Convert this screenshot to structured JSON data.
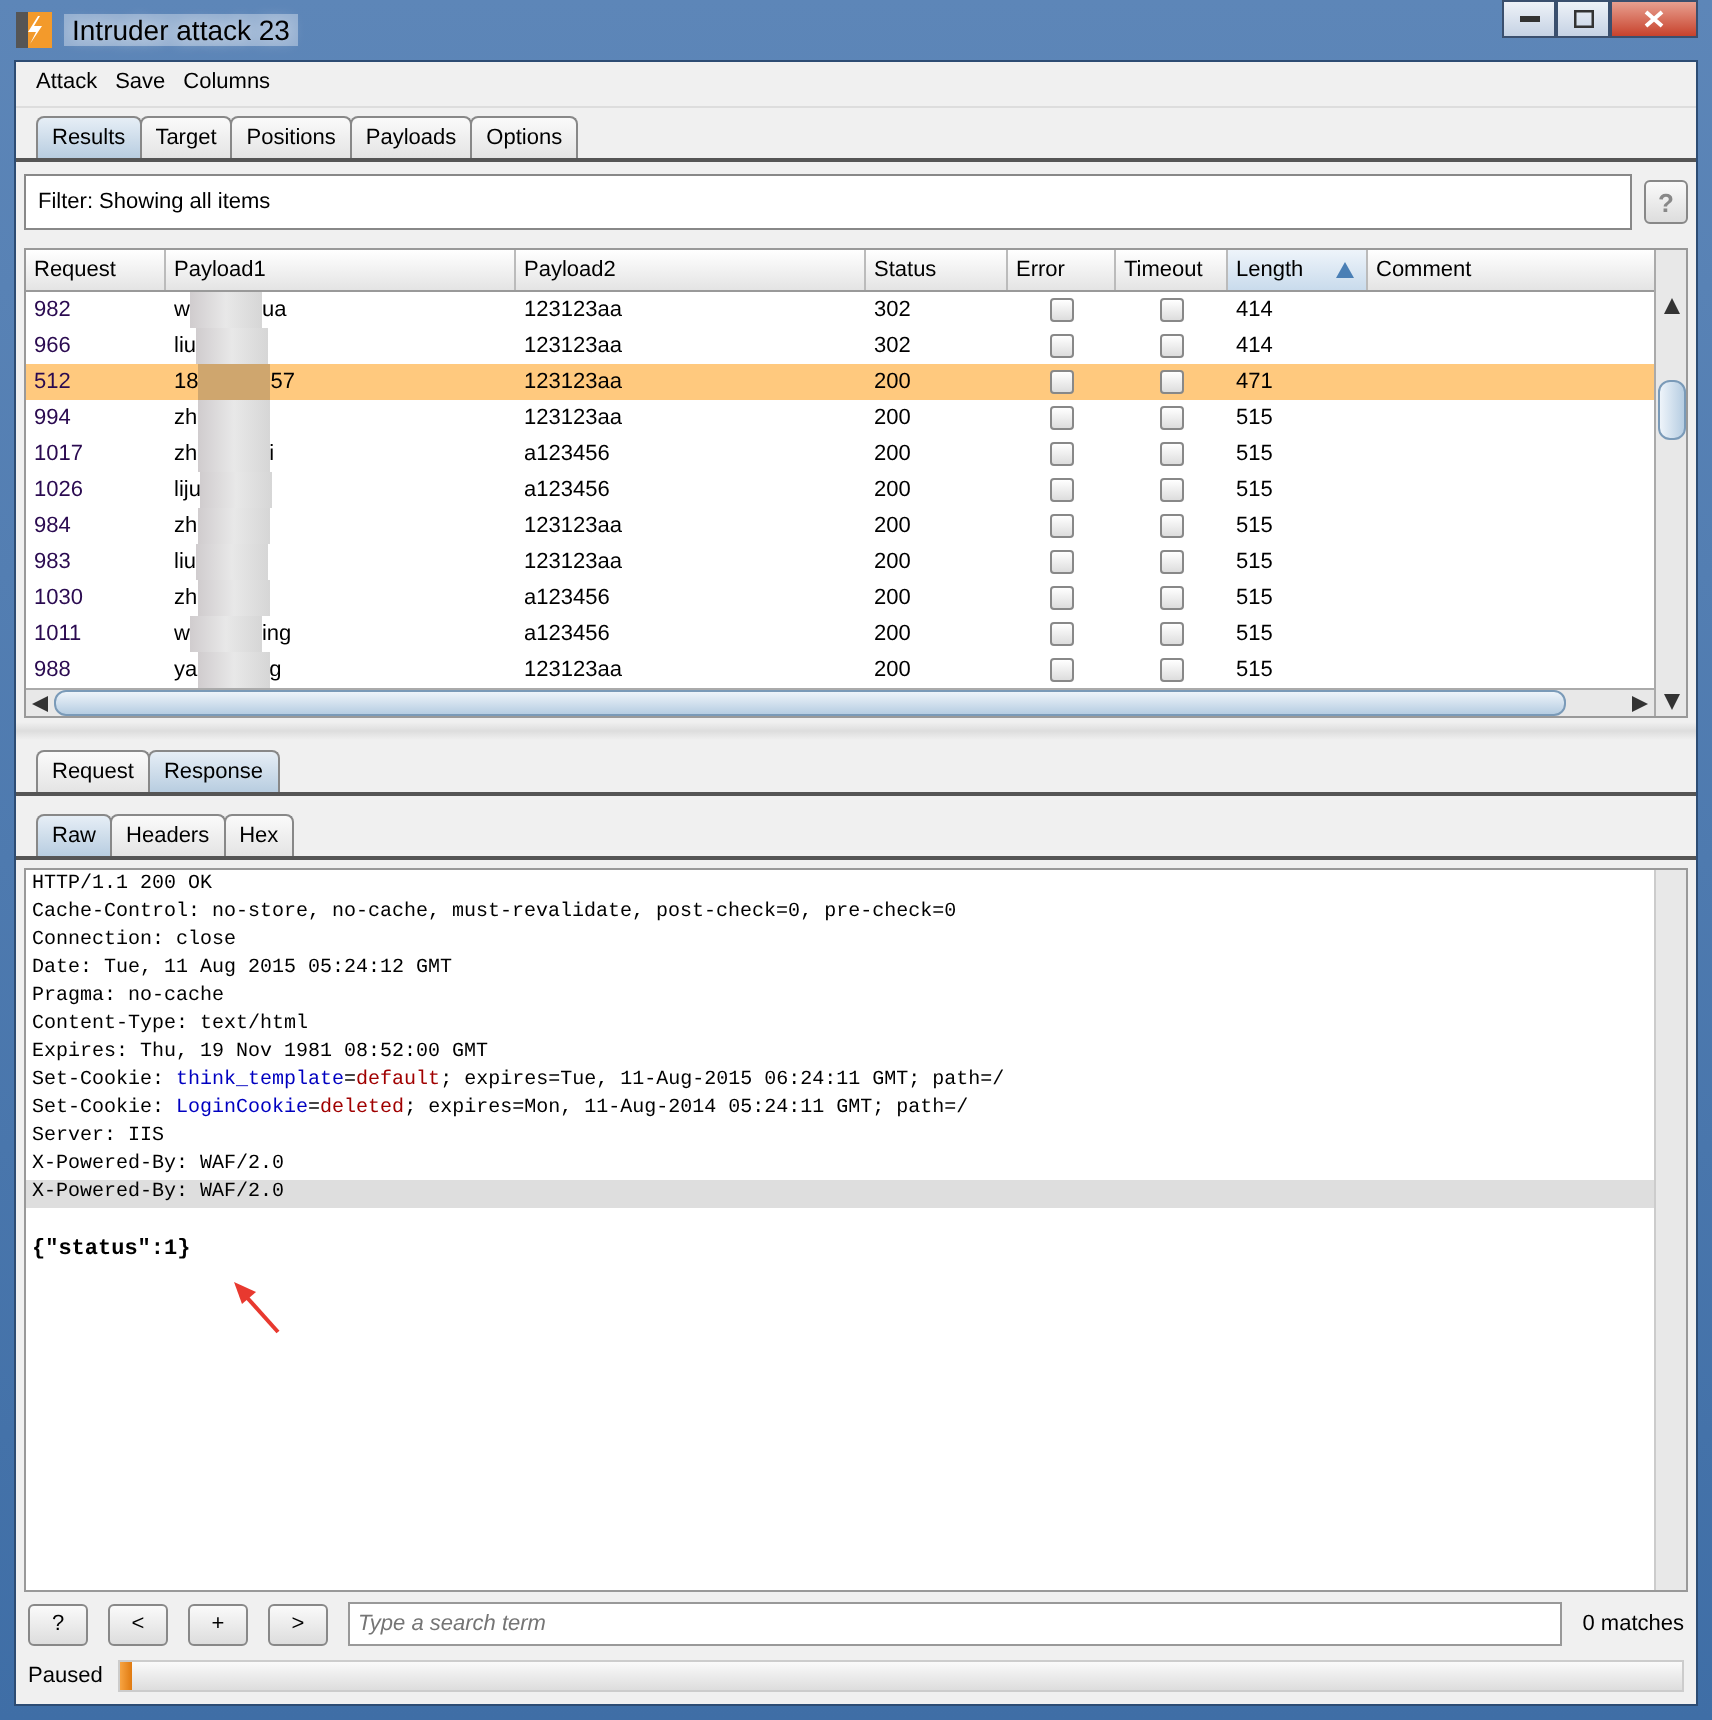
{
  "window": {
    "title": "Intruder attack 23"
  },
  "menu": [
    "Attack",
    "Save",
    "Columns"
  ],
  "tabs": [
    {
      "label": "Results",
      "selected": true
    },
    {
      "label": "Target",
      "selected": false
    },
    {
      "label": "Positions",
      "selected": false
    },
    {
      "label": "Payloads",
      "selected": false
    },
    {
      "label": "Options",
      "selected": false
    }
  ],
  "filter": {
    "text": "Filter:  Showing all items",
    "help": "?"
  },
  "table": {
    "columns": [
      {
        "label": "Request",
        "sorted": false
      },
      {
        "label": "Payload1",
        "sorted": false
      },
      {
        "label": "Payload2",
        "sorted": false
      },
      {
        "label": "Status",
        "sorted": false
      },
      {
        "label": "Error",
        "sorted": false
      },
      {
        "label": "Timeout",
        "sorted": false
      },
      {
        "label": "Length",
        "sorted": true
      },
      {
        "label": "Comment",
        "sorted": false
      }
    ],
    "rows": [
      {
        "request": "982",
        "payload1": {
          "start": "w",
          "end": "ua"
        },
        "payload2": "123123aa",
        "status": "302",
        "error": false,
        "timeout": false,
        "length": "414",
        "selected": false
      },
      {
        "request": "966",
        "payload1": {
          "start": "liu"
        },
        "payload2": "123123aa",
        "status": "302",
        "error": false,
        "timeout": false,
        "length": "414",
        "selected": false
      },
      {
        "request": "512",
        "payload1": {
          "start": "18",
          "end": "57"
        },
        "payload2": "123123aa",
        "status": "200",
        "error": false,
        "timeout": false,
        "length": "471",
        "selected": true
      },
      {
        "request": "994",
        "payload1": {
          "start": "zh"
        },
        "payload2": "123123aa",
        "status": "200",
        "error": false,
        "timeout": false,
        "length": "515",
        "selected": false
      },
      {
        "request": "1017",
        "payload1": {
          "start": "zh",
          "end": "i"
        },
        "payload2": "a123456",
        "status": "200",
        "error": false,
        "timeout": false,
        "length": "515",
        "selected": false
      },
      {
        "request": "1026",
        "payload1": {
          "start": "liju"
        },
        "payload2": "a123456",
        "status": "200",
        "error": false,
        "timeout": false,
        "length": "515",
        "selected": false
      },
      {
        "request": "984",
        "payload1": {
          "start": "zh"
        },
        "payload2": "123123aa",
        "status": "200",
        "error": false,
        "timeout": false,
        "length": "515",
        "selected": false
      },
      {
        "request": "983",
        "payload1": {
          "start": "liu"
        },
        "payload2": "123123aa",
        "status": "200",
        "error": false,
        "timeout": false,
        "length": "515",
        "selected": false
      },
      {
        "request": "1030",
        "payload1": {
          "start": "zh"
        },
        "payload2": "a123456",
        "status": "200",
        "error": false,
        "timeout": false,
        "length": "515",
        "selected": false
      },
      {
        "request": "1011",
        "payload1": {
          "start": "w",
          "end": "ing"
        },
        "payload2": "a123456",
        "status": "200",
        "error": false,
        "timeout": false,
        "length": "515",
        "selected": false
      },
      {
        "request": "988",
        "payload1": {
          "start": "ya",
          "end": "g"
        },
        "payload2": "123123aa",
        "status": "200",
        "error": false,
        "timeout": false,
        "length": "515",
        "selected": false
      }
    ]
  },
  "message_tabs": [
    {
      "label": "Request",
      "selected": false
    },
    {
      "label": "Response",
      "selected": true
    }
  ],
  "view_tabs": [
    {
      "label": "Raw",
      "selected": true
    },
    {
      "label": "Headers",
      "selected": false
    },
    {
      "label": "Hex",
      "selected": false
    }
  ],
  "response": {
    "lines": [
      {
        "highlighted": false,
        "segments": [
          {
            "kind": "plain",
            "text": "HTTP/1.1 200 OK"
          }
        ]
      },
      {
        "highlighted": false,
        "segments": [
          {
            "kind": "plain",
            "text": "Cache-Control: no-store, no-cache, must-revalidate, post-check=0, pre-check=0"
          }
        ]
      },
      {
        "highlighted": false,
        "segments": [
          {
            "kind": "plain",
            "text": "Connection: close"
          }
        ]
      },
      {
        "highlighted": false,
        "segments": [
          {
            "kind": "plain",
            "text": "Date: Tue, 11 Aug 2015 05:24:12 GMT"
          }
        ]
      },
      {
        "highlighted": false,
        "segments": [
          {
            "kind": "plain",
            "text": "Pragma: no-cache"
          }
        ]
      },
      {
        "highlighted": false,
        "segments": [
          {
            "kind": "plain",
            "text": "Content-Type: text/html"
          }
        ]
      },
      {
        "highlighted": false,
        "segments": [
          {
            "kind": "plain",
            "text": "Expires: Thu, 19 Nov 1981 08:52:00 GMT"
          }
        ]
      },
      {
        "highlighted": false,
        "segments": [
          {
            "kind": "plain",
            "text": "Set-Cookie: "
          },
          {
            "kind": "name",
            "text": "think_template"
          },
          {
            "kind": "plain",
            "text": "="
          },
          {
            "kind": "value",
            "text": "default"
          },
          {
            "kind": "plain",
            "text": "; expires=Tue, 11-Aug-2015 06:24:11 GMT; path=/"
          }
        ]
      },
      {
        "highlighted": false,
        "segments": [
          {
            "kind": "plain",
            "text": "Set-Cookie: "
          },
          {
            "kind": "name",
            "text": "LoginCookie"
          },
          {
            "kind": "plain",
            "text": "="
          },
          {
            "kind": "value",
            "text": "deleted"
          },
          {
            "kind": "plain",
            "text": "; expires=Mon, 11-Aug-2014 05:24:11 GMT; path=/"
          }
        ]
      },
      {
        "highlighted": false,
        "segments": [
          {
            "kind": "plain",
            "text": "Server: IIS"
          }
        ]
      },
      {
        "highlighted": false,
        "segments": [
          {
            "kind": "plain",
            "text": "X-Powered-By: WAF/2.0"
          }
        ]
      },
      {
        "highlighted": true,
        "segments": [
          {
            "kind": "plain",
            "text": "X-Powered-By: WAF/2.0"
          }
        ]
      }
    ],
    "body": "{\"status\":1}"
  },
  "search": {
    "buttons": [
      "?",
      "<",
      "+",
      ">"
    ],
    "placeholder": "Type a search term",
    "matches": "0 matches"
  },
  "status": {
    "label": "Paused",
    "level": 0.0
  }
}
